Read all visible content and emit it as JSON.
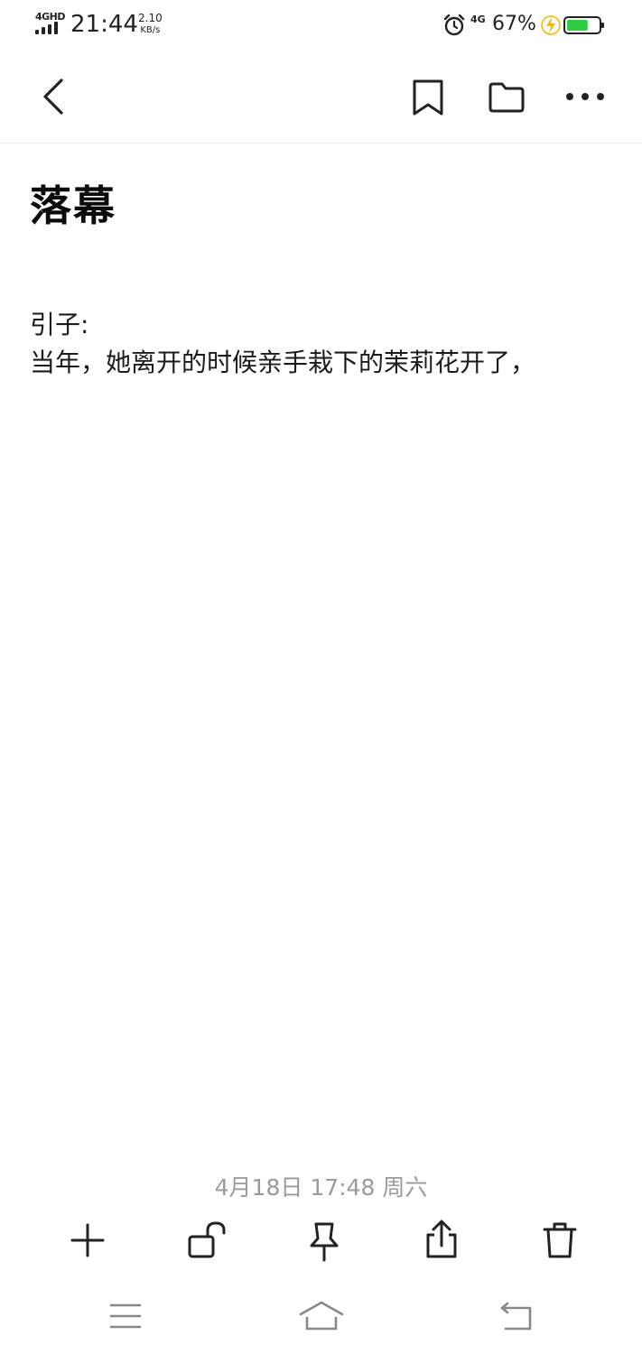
{
  "status_bar": {
    "network_left": "4GHD",
    "time": "21:44",
    "speed_value": "2.10",
    "speed_unit": "KB/s",
    "network_right": "4G",
    "battery_percent": "67%",
    "battery_level": 0.67,
    "accent": "#2ecc40"
  },
  "app_bar": {
    "back_icon": "chevron-left-icon",
    "actions": [
      "bookmark-icon",
      "folder-icon",
      "more-icon"
    ]
  },
  "note": {
    "title": "落幕",
    "lines": [
      "引子:",
      "当年，她离开的时候亲手栽下的茉莉花开了，"
    ],
    "timestamp": "4月18日 17:48 周六"
  },
  "toolbar": {
    "icons": [
      "plus-icon",
      "unlock-icon",
      "pin-icon",
      "share-icon",
      "trash-icon"
    ]
  },
  "nav_bar": {
    "icons": [
      "menu-icon",
      "home-icon",
      "back-arrow-icon"
    ]
  }
}
